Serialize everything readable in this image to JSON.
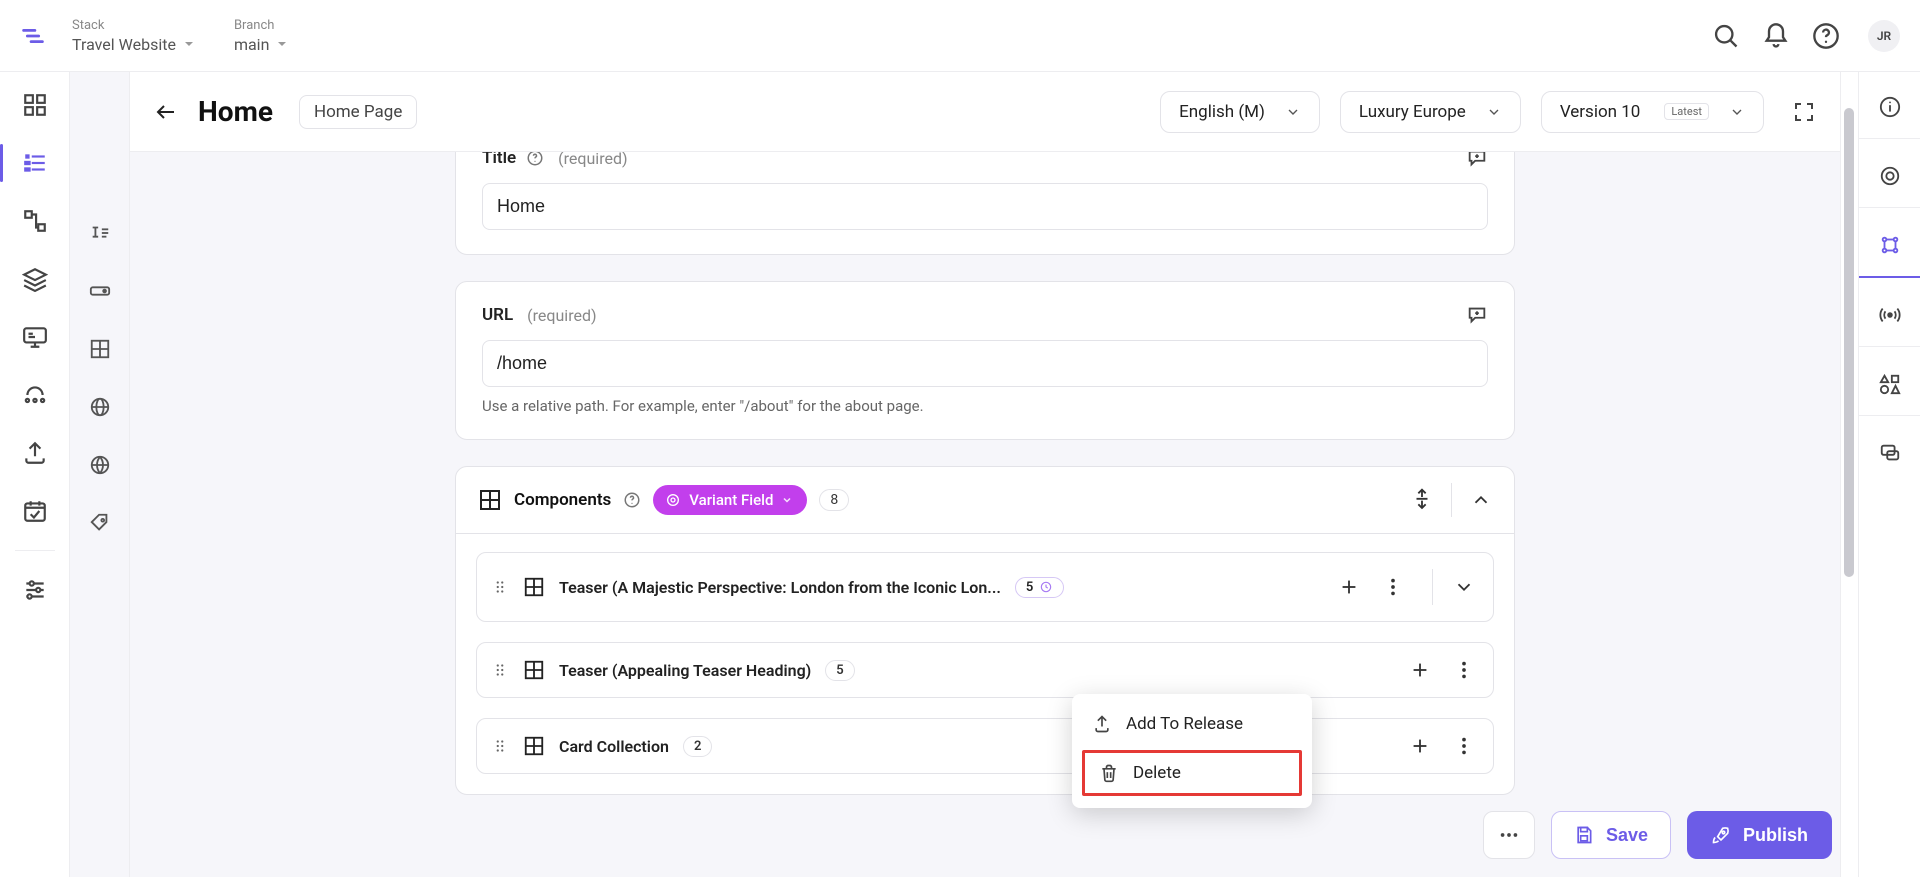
{
  "topbar": {
    "stack_label": "Stack",
    "stack_value": "Travel Website",
    "branch_label": "Branch",
    "branch_value": "main",
    "user_initials": "JR"
  },
  "entry": {
    "back_title": "Home",
    "content_type": "Home Page",
    "locale": "English (M)",
    "variant": "Luxury Europe",
    "version": "Version 10",
    "version_tag": "Latest"
  },
  "fields": {
    "title": {
      "label": "Title",
      "required": "(required)",
      "value": "Home"
    },
    "url": {
      "label": "URL",
      "required": "(required)",
      "value": "/home",
      "hint": "Use a relative path. For example, enter \"/about\" for the about page."
    }
  },
  "components": {
    "label": "Components",
    "variant_field_label": "Variant Field",
    "count": "8",
    "items": [
      {
        "title": "Teaser (A Majestic Perspective: London from the Iconic Lon...",
        "badge": "5",
        "badge_variant": true,
        "has_expand": true
      },
      {
        "title": "Teaser (Appealing Teaser Heading)",
        "badge": "5",
        "badge_variant": false,
        "has_expand": false
      },
      {
        "title": "Card Collection",
        "badge": "2",
        "badge_variant": false,
        "has_expand": false
      }
    ]
  },
  "context_menu": {
    "add_to_release": "Add To Release",
    "delete": "Delete"
  },
  "footer": {
    "save": "Save",
    "publish": "Publish"
  }
}
